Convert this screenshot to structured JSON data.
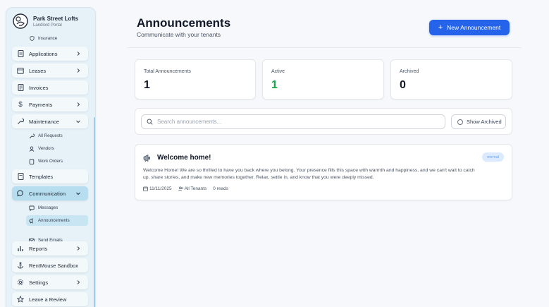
{
  "brand": {
    "name": "Park Street Lofts",
    "subtitle": "Landlord Portal"
  },
  "sidebar": {
    "partial_item": "Insurance",
    "items": [
      {
        "label": "Applications"
      },
      {
        "label": "Leases"
      },
      {
        "label": "Invoices"
      },
      {
        "label": "Payments"
      },
      {
        "label": "Maintenance"
      },
      {
        "label": "Templates"
      },
      {
        "label": "Communication"
      },
      {
        "label": "Reports"
      },
      {
        "label": "RentMouse Sandbox"
      },
      {
        "label": "Settings"
      },
      {
        "label": "Leave a Review"
      }
    ],
    "maintenance_sub": [
      "All Requests",
      "Vendors",
      "Work Orders"
    ],
    "communication_sub": [
      "Messages",
      "Announcements",
      "Send Emails"
    ]
  },
  "header": {
    "title": "Announcements",
    "subtitle": "Communicate with your tenants",
    "new_button": "New Announcement"
  },
  "stats": [
    {
      "label": "Total Announcements",
      "value": "1"
    },
    {
      "label": "Active",
      "value": "1"
    },
    {
      "label": "Archived",
      "value": "0"
    }
  ],
  "search": {
    "placeholder": "Search announcements...",
    "show_archived": "Show Archived"
  },
  "announcement": {
    "title": "Welcome home!",
    "badge": "normal",
    "body": "Welcome Home! We are so thrilled to have you back where you belong. Your presence fills this space with warmth and happiness, and we can't wait to catch up, share stories, and make new memories together. Relax, settle in, and know that you were deeply missed.",
    "date": "11/11/2025",
    "audience": "All Tenants",
    "reads": "0 reads"
  },
  "colors": {
    "accent": "#2563eb",
    "active_green": "#16a34a",
    "sidebar_bg": "#e6f1f8"
  }
}
